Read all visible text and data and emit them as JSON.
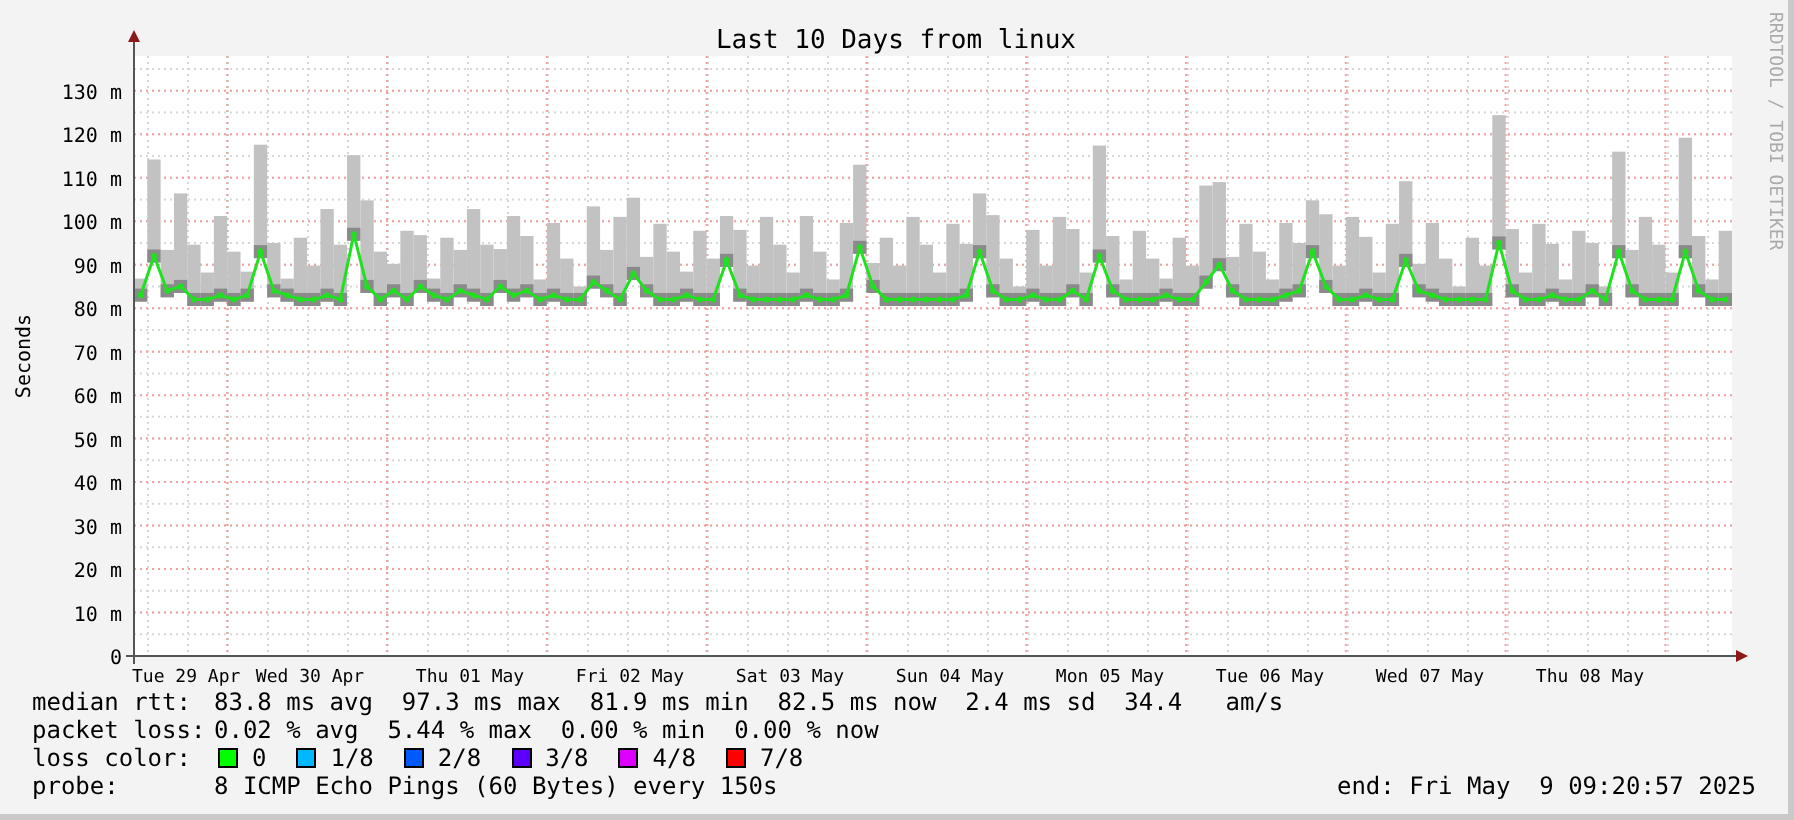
{
  "chart": {
    "credit": "RRDTOOL / TOBI OETIKER",
    "day_labels": [
      "Tue 29 Apr",
      "Wed 30 Apr",
      "Thu 01 May",
      "Fri 02 May",
      "Sat 03 May",
      "Sun 04 May",
      "Mon 05 May",
      "Tue 06 May",
      "Wed 07 May",
      "Thu 08 May"
    ],
    "chart_data": {
      "type": "line",
      "title": "Last 10 Days from linux",
      "ylabel": "Seconds",
      "ylim": [
        0,
        138
      ],
      "grid": true,
      "yticks": [
        {
          "value": 0,
          "label": "0"
        },
        {
          "value": 10,
          "label": "10 m"
        },
        {
          "value": 20,
          "label": "20 m"
        },
        {
          "value": 30,
          "label": "30 m"
        },
        {
          "value": 40,
          "label": "40 m"
        },
        {
          "value": 50,
          "label": "50 m"
        },
        {
          "value": 60,
          "label": "60 m"
        },
        {
          "value": 70,
          "label": "70 m"
        },
        {
          "value": 80,
          "label": "80 m"
        },
        {
          "value": 90,
          "label": "90 m"
        },
        {
          "value": 100,
          "label": "100 m"
        },
        {
          "value": 110,
          "label": "110 m"
        },
        {
          "value": 120,
          "label": "120 m"
        },
        {
          "value": 130,
          "label": "130 m"
        }
      ],
      "series": [
        {
          "color": "#20e020",
          "marker": "dot",
          "values": [
            83,
            92,
            84,
            85,
            82,
            82,
            83,
            82,
            83,
            93,
            84,
            83,
            82,
            82,
            83,
            82,
            97,
            85,
            82,
            84,
            82,
            85,
            83,
            82,
            84,
            83,
            82,
            85,
            83,
            84,
            82,
            83,
            82,
            82,
            86,
            84,
            82,
            88,
            84,
            82,
            82,
            83,
            82,
            82,
            91,
            83,
            82,
            82,
            82,
            82,
            83,
            82,
            82,
            83,
            94,
            85,
            82,
            82,
            82,
            82,
            82,
            82,
            83,
            93,
            84,
            82,
            82,
            83,
            82,
            82,
            84,
            82,
            92,
            84,
            82,
            82,
            82,
            83,
            82,
            82,
            86,
            90,
            84,
            82,
            82,
            82,
            83,
            84,
            93,
            85,
            82,
            82,
            83,
            82,
            82,
            91,
            84,
            83,
            82,
            82,
            82,
            82,
            95,
            84,
            82,
            82,
            83,
            82,
            82,
            84,
            82,
            93,
            84,
            82,
            82,
            82,
            93,
            84,
            82,
            82
          ]
        }
      ]
    }
  },
  "legend": {
    "median_rtt": {
      "label": "median rtt:",
      "text": "83.8 ms avg  97.3 ms max  81.9 ms min  82.5 ms now  2.4 ms sd  34.4   am/s"
    },
    "packet_loss": {
      "label": "packet loss:",
      "text": "0.02 % avg  5.44 % max  0.00 % min  0.00 % now"
    },
    "loss_colors": {
      "label": "loss color:",
      "items": [
        {
          "label": "0",
          "color": "#00ff00"
        },
        {
          "label": "1/8",
          "color": "#00b8ff"
        },
        {
          "label": "2/8",
          "color": "#0059ff"
        },
        {
          "label": "3/8",
          "color": "#5e00ff"
        },
        {
          "label": "4/8",
          "color": "#dd00ff"
        },
        {
          "label": "7/8",
          "color": "#ff0000"
        }
      ]
    },
    "probe": {
      "label": "probe:",
      "text": "8 ICMP Echo Pings (60 Bytes) every 150s"
    },
    "end": "end: Fri May  9 09:20:57 2025"
  }
}
